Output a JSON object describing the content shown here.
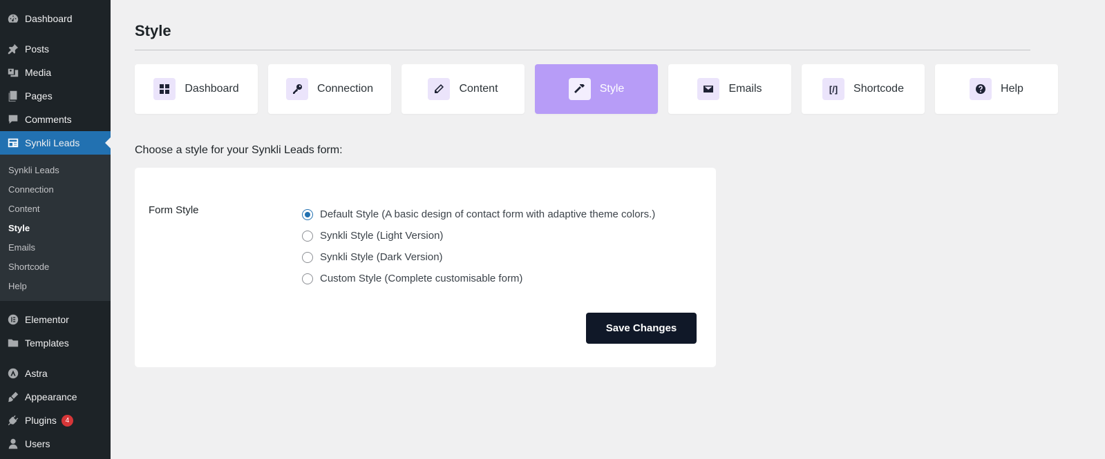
{
  "sidebar": {
    "top_items": [
      {
        "label": "Dashboard",
        "icon": "dashboard-icon"
      },
      {
        "label": "Posts",
        "icon": "pin-icon"
      },
      {
        "label": "Media",
        "icon": "media-icon"
      },
      {
        "label": "Pages",
        "icon": "pages-icon"
      },
      {
        "label": "Comments",
        "icon": "comment-icon"
      }
    ],
    "active_item": {
      "label": "Synkli Leads",
      "icon": "form-icon"
    },
    "submenu": [
      "Synkli Leads",
      "Connection",
      "Content",
      "Style",
      "Emails",
      "Shortcode",
      "Help"
    ],
    "submenu_current": "Style",
    "bottom_items": [
      {
        "label": "Elementor",
        "icon": "elementor-icon"
      },
      {
        "label": "Templates",
        "icon": "folder-icon"
      },
      {
        "label": "Astra",
        "icon": "astra-icon"
      },
      {
        "label": "Appearance",
        "icon": "brush-icon"
      },
      {
        "label": "Plugins",
        "icon": "plugin-icon",
        "badge": "4"
      },
      {
        "label": "Users",
        "icon": "user-icon"
      }
    ]
  },
  "page": {
    "title": "Style"
  },
  "tabs": [
    {
      "label": "Dashboard",
      "icon": "grid-icon",
      "active": false
    },
    {
      "label": "Connection",
      "icon": "key-icon",
      "active": false
    },
    {
      "label": "Content",
      "icon": "pencil-icon",
      "active": false
    },
    {
      "label": "Style",
      "icon": "hammer-icon",
      "active": true
    },
    {
      "label": "Emails",
      "icon": "envelope-icon",
      "active": false
    },
    {
      "label": "Shortcode",
      "icon": "shortcode-icon",
      "glyph": "[/]",
      "active": false
    },
    {
      "label": "Help",
      "icon": "help-icon",
      "active": false
    }
  ],
  "form": {
    "heading": "Choose a style for your Synkli Leads form:",
    "field_label": "Form Style",
    "options": [
      {
        "label": "Default Style (A basic design of contact form with adaptive theme colors.)",
        "checked": true
      },
      {
        "label": "Synkli Style (Light Version)",
        "checked": false
      },
      {
        "label": "Synkli Style (Dark Version)",
        "checked": false
      },
      {
        "label": "Custom Style (Complete customisable form)",
        "checked": false
      }
    ],
    "save_label": "Save Changes"
  },
  "colors": {
    "sidebar_bg": "#1d2327",
    "active_menu": "#2271b1",
    "active_tab": "#b79cf7",
    "button": "#101828",
    "badge": "#d63638"
  }
}
